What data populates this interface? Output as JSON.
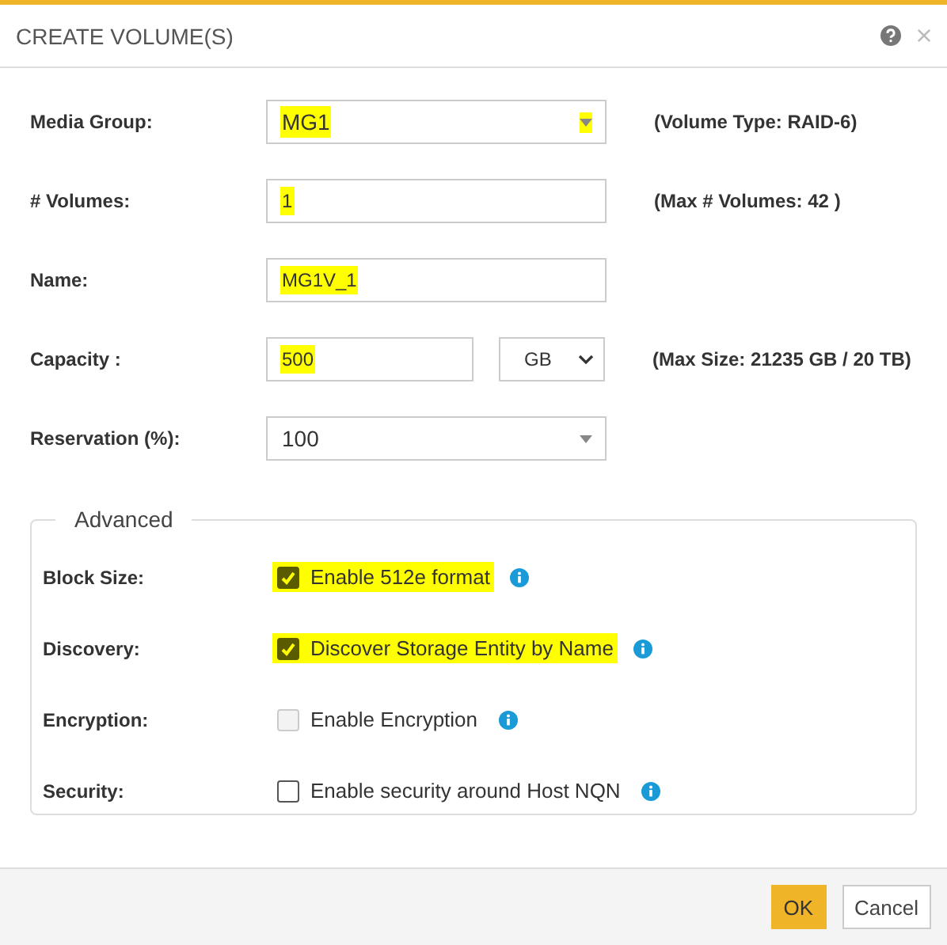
{
  "dialog": {
    "title": "CREATE VOLUME(S)"
  },
  "fields": [
    {
      "label": "Media Group:",
      "kind": "select",
      "value": "MG1",
      "highlighted": true,
      "note": "(Volume Type: RAID-6)"
    },
    {
      "label": "# Volumes:",
      "kind": "text",
      "value": "1",
      "highlighted": true,
      "note": "(Max # Volumes: 42 )"
    },
    {
      "label": "Name:",
      "kind": "text",
      "value": "MG1V_1",
      "highlighted": true
    },
    {
      "label": "Capacity :",
      "kind": "text-unit",
      "value": "500",
      "unit": "GB",
      "highlighted": true,
      "note": "(Max Size: 21235 GB / 20 TB)"
    },
    {
      "label": "Reservation (%):",
      "kind": "select",
      "value": "100",
      "highlighted": false
    }
  ],
  "advanced": {
    "legend": "Advanced",
    "options": [
      {
        "label": "Block Size:",
        "text": "Enable 512e format",
        "checked": true,
        "disabled": false,
        "highlighted": true
      },
      {
        "label": "Discovery:",
        "text": "Discover Storage Entity by Name",
        "checked": true,
        "disabled": false,
        "highlighted": true
      },
      {
        "label": "Encryption:",
        "text": "Enable Encryption",
        "checked": false,
        "disabled": true,
        "highlighted": false
      },
      {
        "label": "Security:",
        "text": "Enable security around Host NQN",
        "checked": false,
        "disabled": false,
        "highlighted": false
      }
    ]
  },
  "buttons": [
    {
      "label": "OK",
      "kind": "primary"
    },
    {
      "label": "Cancel",
      "kind": "secondary"
    }
  ]
}
